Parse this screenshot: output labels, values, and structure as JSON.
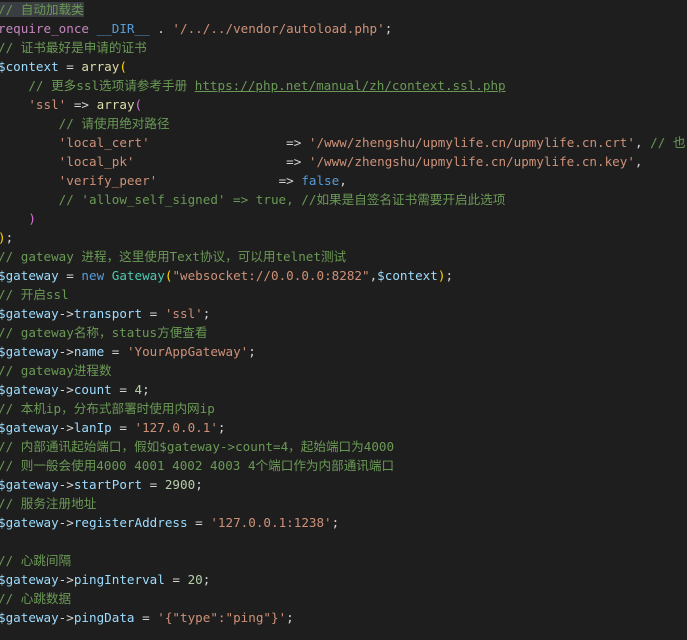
{
  "lines": [
    [
      {
        "t": "// 自动加载类",
        "c": "c"
      }
    ],
    [
      {
        "t": "require_once",
        "c": "m"
      },
      {
        "t": " ",
        "c": "p"
      },
      {
        "t": "__DIR__",
        "c": "k"
      },
      {
        "t": " . ",
        "c": "p"
      },
      {
        "t": "'/../../vendor/autoload.php'",
        "c": "s"
      },
      {
        "t": ";",
        "c": "p"
      }
    ],
    [
      {
        "t": "// 证书最好是申请的证书",
        "c": "c"
      }
    ],
    [
      {
        "t": "$context",
        "c": "v"
      },
      {
        "t": " = ",
        "c": "p"
      },
      {
        "t": "array",
        "c": "f"
      },
      {
        "t": "(",
        "c": "b1"
      }
    ],
    [
      {
        "t": "    ",
        "c": "p"
      },
      {
        "t": "// 更多ssl选项请参考手册 ",
        "c": "c"
      },
      {
        "t": "https://php.net/manual/zh/context.ssl.php",
        "c": "u"
      }
    ],
    [
      {
        "t": "    ",
        "c": "p"
      },
      {
        "t": "'ssl'",
        "c": "s"
      },
      {
        "t": " => ",
        "c": "p"
      },
      {
        "t": "array",
        "c": "f"
      },
      {
        "t": "(",
        "c": "b2"
      }
    ],
    [
      {
        "t": "        ",
        "c": "p"
      },
      {
        "t": "// 请使用绝对路径",
        "c": "c"
      }
    ],
    [
      {
        "t": "        ",
        "c": "p"
      },
      {
        "t": "'local_cert'",
        "c": "s"
      },
      {
        "t": "                  => ",
        "c": "p"
      },
      {
        "t": "'/www/zhengshu/upmylife.cn/upmylife.cn.crt'",
        "c": "s"
      },
      {
        "t": ", ",
        "c": "p"
      },
      {
        "t": "// 也",
        "c": "c"
      }
    ],
    [
      {
        "t": "        ",
        "c": "p"
      },
      {
        "t": "'local_pk'",
        "c": "s"
      },
      {
        "t": "                    => ",
        "c": "p"
      },
      {
        "t": "'/www/zhengshu/upmylife.cn/upmylife.cn.key'",
        "c": "s"
      },
      {
        "t": ",",
        "c": "p"
      }
    ],
    [
      {
        "t": "        ",
        "c": "p"
      },
      {
        "t": "'verify_peer'",
        "c": "s"
      },
      {
        "t": "                => ",
        "c": "p"
      },
      {
        "t": "false",
        "c": "k"
      },
      {
        "t": ",",
        "c": "p"
      }
    ],
    [
      {
        "t": "        ",
        "c": "p"
      },
      {
        "t": "// 'allow_self_signed' => true, //如果是自签名证书需要开启此选项",
        "c": "c"
      }
    ],
    [
      {
        "t": "    ",
        "c": "p"
      },
      {
        "t": ")",
        "c": "b2"
      }
    ],
    [
      {
        "t": ")",
        "c": "b1"
      },
      {
        "t": ";",
        "c": "p"
      }
    ],
    [
      {
        "t": "// gateway 进程，这里使用Text协议，可以用telnet测试",
        "c": "c"
      }
    ],
    [
      {
        "t": "$gateway",
        "c": "v"
      },
      {
        "t": " = ",
        "c": "p"
      },
      {
        "t": "new",
        "c": "k"
      },
      {
        "t": " ",
        "c": "p"
      },
      {
        "t": "Gateway",
        "c": "t"
      },
      {
        "t": "(",
        "c": "b1"
      },
      {
        "t": "\"websocket://0.0.0.0:8282\"",
        "c": "s"
      },
      {
        "t": ",",
        "c": "p"
      },
      {
        "t": "$context",
        "c": "v"
      },
      {
        "t": ")",
        "c": "b1"
      },
      {
        "t": ";",
        "c": "p"
      }
    ],
    [
      {
        "t": "// 开启ssl",
        "c": "c"
      }
    ],
    [
      {
        "t": "$gateway",
        "c": "v"
      },
      {
        "t": "->",
        "c": "p"
      },
      {
        "t": "transport",
        "c": "v"
      },
      {
        "t": " = ",
        "c": "p"
      },
      {
        "t": "'ssl'",
        "c": "s"
      },
      {
        "t": ";",
        "c": "p"
      }
    ],
    [
      {
        "t": "// gateway名称，status方便查看",
        "c": "c"
      }
    ],
    [
      {
        "t": "$gateway",
        "c": "v"
      },
      {
        "t": "->",
        "c": "p"
      },
      {
        "t": "name",
        "c": "v"
      },
      {
        "t": " = ",
        "c": "p"
      },
      {
        "t": "'YourAppGateway'",
        "c": "s"
      },
      {
        "t": ";",
        "c": "p"
      }
    ],
    [
      {
        "t": "// gateway进程数",
        "c": "c"
      }
    ],
    [
      {
        "t": "$gateway",
        "c": "v"
      },
      {
        "t": "->",
        "c": "p"
      },
      {
        "t": "count",
        "c": "v"
      },
      {
        "t": " = ",
        "c": "p"
      },
      {
        "t": "4",
        "c": "n"
      },
      {
        "t": ";",
        "c": "p"
      }
    ],
    [
      {
        "t": "// 本机ip，分布式部署时使用内网ip",
        "c": "c"
      }
    ],
    [
      {
        "t": "$gateway",
        "c": "v"
      },
      {
        "t": "->",
        "c": "p"
      },
      {
        "t": "lanIp",
        "c": "v"
      },
      {
        "t": " = ",
        "c": "p"
      },
      {
        "t": "'127.0.0.1'",
        "c": "s"
      },
      {
        "t": ";",
        "c": "p"
      }
    ],
    [
      {
        "t": "// 内部通讯起始端口，假如$gateway->count=4，起始端口为4000",
        "c": "c"
      }
    ],
    [
      {
        "t": "// 则一般会使用4000 4001 4002 4003 4个端口作为内部通讯端口",
        "c": "c"
      }
    ],
    [
      {
        "t": "$gateway",
        "c": "v"
      },
      {
        "t": "->",
        "c": "p"
      },
      {
        "t": "startPort",
        "c": "v"
      },
      {
        "t": " = ",
        "c": "p"
      },
      {
        "t": "2900",
        "c": "n"
      },
      {
        "t": ";",
        "c": "p"
      }
    ],
    [
      {
        "t": "// 服务注册地址",
        "c": "c"
      }
    ],
    [
      {
        "t": "$gateway",
        "c": "v"
      },
      {
        "t": "->",
        "c": "p"
      },
      {
        "t": "registerAddress",
        "c": "v"
      },
      {
        "t": " = ",
        "c": "p"
      },
      {
        "t": "'127.0.0.1:1238'",
        "c": "s"
      },
      {
        "t": ";",
        "c": "p"
      }
    ],
    [],
    [
      {
        "t": "// 心跳间隔",
        "c": "c"
      }
    ],
    [
      {
        "t": "$gateway",
        "c": "v"
      },
      {
        "t": "->",
        "c": "p"
      },
      {
        "t": "pingInterval",
        "c": "v"
      },
      {
        "t": " = ",
        "c": "p"
      },
      {
        "t": "20",
        "c": "n"
      },
      {
        "t": ";",
        "c": "p"
      }
    ],
    [
      {
        "t": "// 心跳数据",
        "c": "c"
      }
    ],
    [
      {
        "t": "$gateway",
        "c": "v"
      },
      {
        "t": "->",
        "c": "p"
      },
      {
        "t": "pingData",
        "c": "v"
      },
      {
        "t": " = ",
        "c": "p"
      },
      {
        "t": "'{\"type\":\"ping\"}'",
        "c": "s"
      },
      {
        "t": ";",
        "c": "p"
      }
    ]
  ]
}
